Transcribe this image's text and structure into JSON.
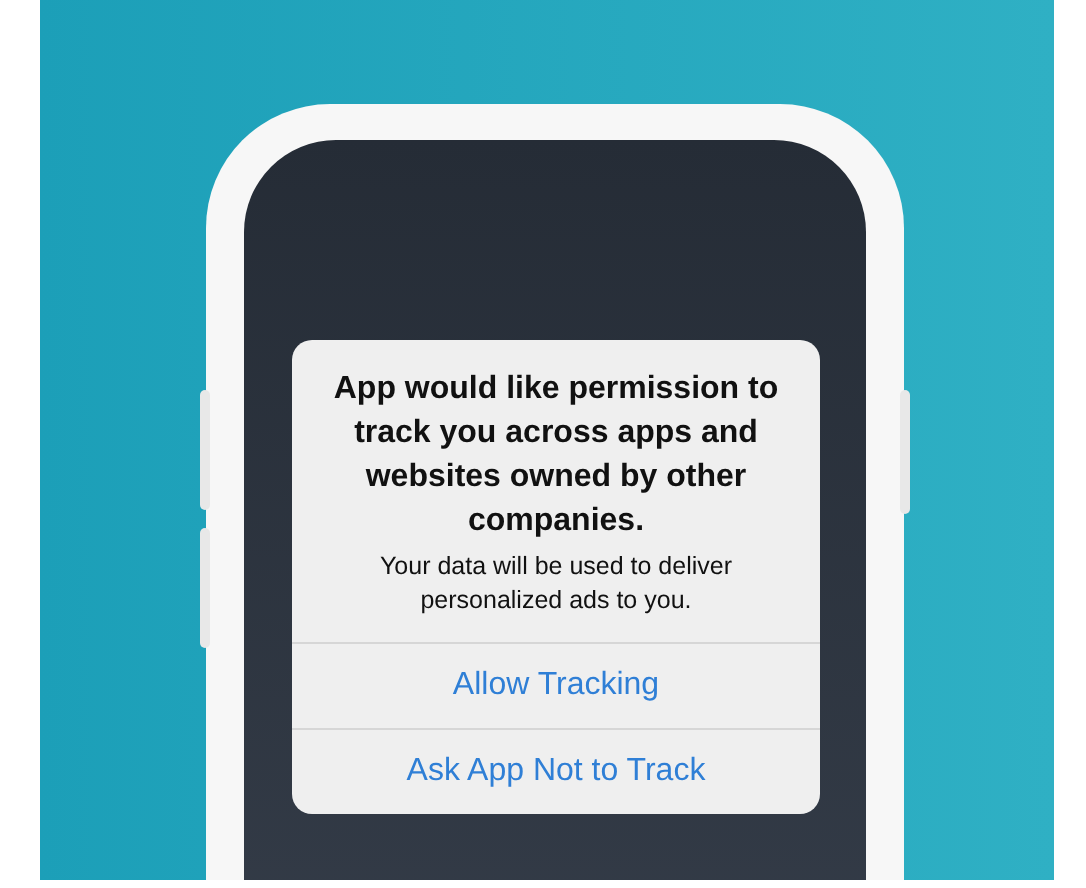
{
  "dialog": {
    "title": "App would like permission to track you across apps and websites owned by other companies.",
    "message": "Your data will be used to deliver personalized ads to you.",
    "buttons": [
      {
        "label": "Allow Tracking"
      },
      {
        "label": "Ask App Not to Track"
      }
    ]
  }
}
